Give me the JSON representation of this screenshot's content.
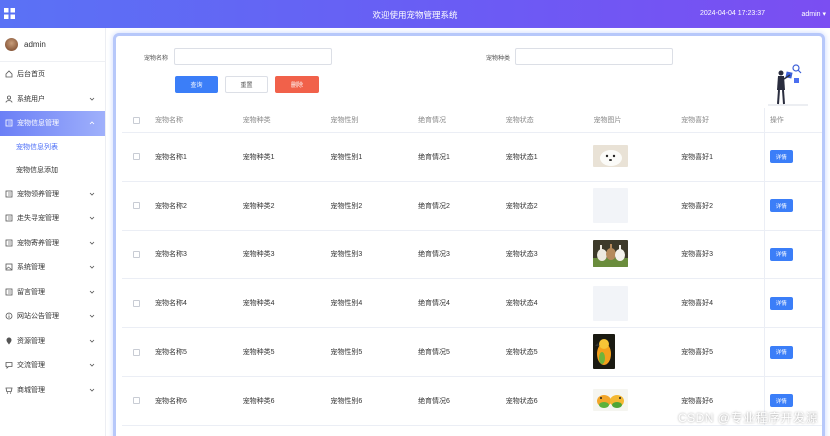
{
  "header": {
    "title": "欢迎使用宠物管理系统",
    "datetime": "2024-04-04 17:23:37",
    "user": "admin"
  },
  "sidebar": {
    "username": "admin",
    "items": [
      {
        "label": "后台首页",
        "icon": "home-icon",
        "hasChevron": false
      },
      {
        "label": "系统用户",
        "icon": "user-icon",
        "hasChevron": true
      },
      {
        "label": "宠物信息管理",
        "icon": "doc-icon",
        "hasChevron": true,
        "active": true
      },
      {
        "label": "宠物领养管理",
        "icon": "doc-icon",
        "hasChevron": true
      },
      {
        "label": "走失寻宠管理",
        "icon": "doc-icon",
        "hasChevron": true
      },
      {
        "label": "宠物寄养管理",
        "icon": "doc-icon",
        "hasChevron": true
      },
      {
        "label": "系统管理",
        "icon": "image-icon",
        "hasChevron": true
      },
      {
        "label": "留言管理",
        "icon": "doc-icon",
        "hasChevron": true
      },
      {
        "label": "网站公告管理",
        "icon": "info-icon",
        "hasChevron": true
      },
      {
        "label": "资源管理",
        "icon": "location-icon",
        "hasChevron": true
      },
      {
        "label": "交流管理",
        "icon": "chat-icon",
        "hasChevron": true
      },
      {
        "label": "商城管理",
        "icon": "shop-icon",
        "hasChevron": true
      }
    ],
    "subitems": [
      "宠物信息列表",
      "宠物信息添加"
    ]
  },
  "search": {
    "name_label": "宠物名称",
    "type_label": "宠物种类",
    "query": "查询",
    "reset": "重置",
    "delete": "删除"
  },
  "table": {
    "columns": [
      "宠物名称",
      "宠物种类",
      "宠物性别",
      "绝育情况",
      "宠物状态",
      "宠物图片",
      "宠物喜好",
      "操作"
    ],
    "detail_label": "详情",
    "rows": [
      {
        "name": "宠物名称1",
        "type": "宠物种类1",
        "gender": "宠物性别1",
        "sterilized": "绝育情况1",
        "status": "宠物状态1",
        "image": "white-dog",
        "hobby": "宠物喜好1"
      },
      {
        "name": "宠物名称2",
        "type": "宠物种类2",
        "gender": "宠物性别2",
        "sterilized": "绝育情况2",
        "status": "宠物状态2",
        "image": "blank",
        "hobby": "宠物喜好2"
      },
      {
        "name": "宠物名称3",
        "type": "宠物种类3",
        "gender": "宠物性别3",
        "sterilized": "绝育情况3",
        "status": "宠物状态3",
        "image": "rabbits",
        "hobby": "宠物喜好3"
      },
      {
        "name": "宠物名称4",
        "type": "宠物种类4",
        "gender": "宠物性别4",
        "sterilized": "绝育情况4",
        "status": "宠物状态4",
        "image": "blank",
        "hobby": "宠物喜好4"
      },
      {
        "name": "宠物名称5",
        "type": "宠物种类5",
        "gender": "宠物性别5",
        "sterilized": "绝育情况5",
        "status": "宠物状态5",
        "image": "parrot",
        "hobby": "宠物喜好5"
      },
      {
        "name": "宠物名称6",
        "type": "宠物种类6",
        "gender": "宠物性别6",
        "sterilized": "绝育情况6",
        "status": "宠物状态6",
        "image": "parrots",
        "hobby": "宠物喜好6"
      }
    ]
  },
  "watermark": "CSDN @专业程序开发源",
  "colors": {
    "accent": "#3b7ef8",
    "danger": "#f1614a",
    "header_start": "#5a72f5",
    "header_end": "#7b4ef2"
  }
}
